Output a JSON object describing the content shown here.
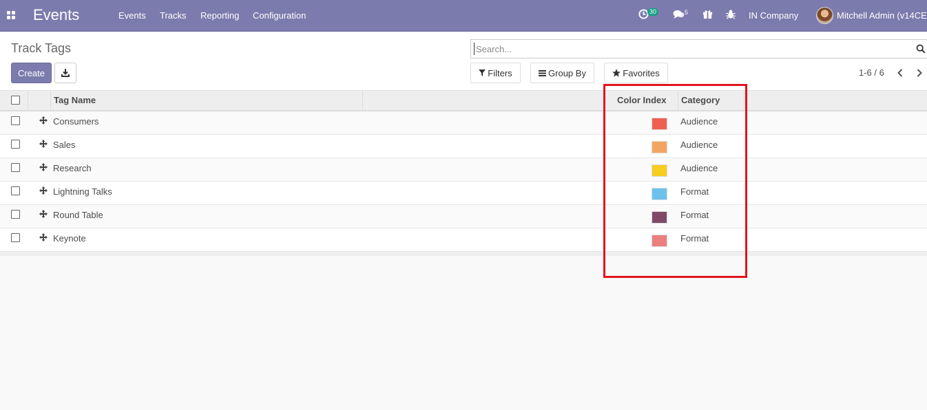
{
  "navbar": {
    "app_name": "Events",
    "menu": [
      "Events",
      "Tracks",
      "Reporting",
      "Configuration"
    ],
    "activity_count": "30",
    "message_count": "5",
    "company": "IN Company",
    "user": "Mitchell Admin (v14CE",
    "color": "#7c7bad"
  },
  "control": {
    "title": "Track Tags",
    "search_placeholder": "Search...",
    "create_label": "Create",
    "filters_label": "Filters",
    "groupby_label": "Group By",
    "favorites_label": "Favorites",
    "pager": "1-6 / 6"
  },
  "table": {
    "headers": {
      "tag_name": "Tag Name",
      "color_index": "Color Index",
      "category": "Category"
    },
    "rows": [
      {
        "name": "Consumers",
        "color": "#f06050",
        "category": "Audience"
      },
      {
        "name": "Sales",
        "color": "#f4a460",
        "category": "Audience"
      },
      {
        "name": "Research",
        "color": "#f7cd1f",
        "category": "Audience"
      },
      {
        "name": "Lightning Talks",
        "color": "#6cc1ed",
        "category": "Format"
      },
      {
        "name": "Round Table",
        "color": "#814968",
        "category": "Format"
      },
      {
        "name": "Keynote",
        "color": "#eb7e7f",
        "category": "Format"
      }
    ]
  },
  "annotation": {
    "highlight_color": "#e3141e"
  }
}
